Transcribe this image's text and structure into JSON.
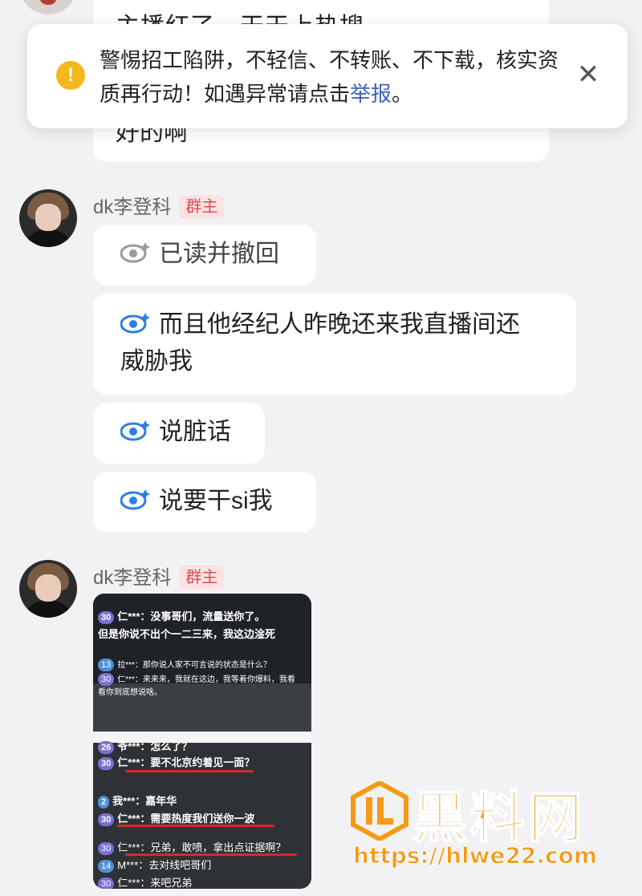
{
  "chat": {
    "prev_partial_text": "主播红了，天天上热搜",
    "prev_last_line": "好的啊",
    "sender_name": "dk李登科",
    "sender_role": "群主",
    "messages": [
      {
        "text": "已读并撤回",
        "state": "recalled"
      },
      {
        "text": "而且他经纪人昨晚还来我直播间还",
        "text2": "威胁我",
        "state": "read"
      },
      {
        "text": "说脏话",
        "state": "read"
      },
      {
        "text": "说要干si我",
        "state": "read"
      }
    ]
  },
  "warning": {
    "text": "警惕招工陷阱，不轻信、不转账、不下载，核实资质再行动！如遇异常请点击",
    "link": "举报",
    "tail": "。",
    "icon": "exclamation-icon",
    "close_icon": "close-icon",
    "accent": "#f4b71e",
    "link_color": "#3e63ba"
  },
  "image_message": {
    "lines": [
      {
        "lv": "30",
        "text": "仁***：没事哥们，流量送你了。"
      },
      {
        "lv": "",
        "text": "但是你说不出个一二三来，我这边淦死"
      },
      {
        "lv": "13",
        "text": "拉***：那你说人家不可言说的状态是什么？"
      },
      {
        "lv": "30",
        "text": "仁***：来来来，我就在这边，我等着你爆料，我看"
      },
      {
        "lv": "",
        "text": "看你到底想说啥。"
      },
      {
        "lv": "26",
        "text": "爷***：怎么了？"
      },
      {
        "lv": "30",
        "text": "仁***：要不北京约着见一面？"
      },
      {
        "lv": "2",
        "text": "我***：嘉年华"
      },
      {
        "lv": "30",
        "text": "仁***：需要热度我们送你一波"
      },
      {
        "lv": "30",
        "text": "仁***：兄弟，敢喷，拿出点证据啊？"
      },
      {
        "lv": "14",
        "text": "M***：去对线吧哥们"
      },
      {
        "lv": "30",
        "text": "仁***：来吧兄弟"
      }
    ]
  },
  "watermark": {
    "name": "黑料网",
    "url": "https://hlwe22.com",
    "color": "#f59a16"
  }
}
